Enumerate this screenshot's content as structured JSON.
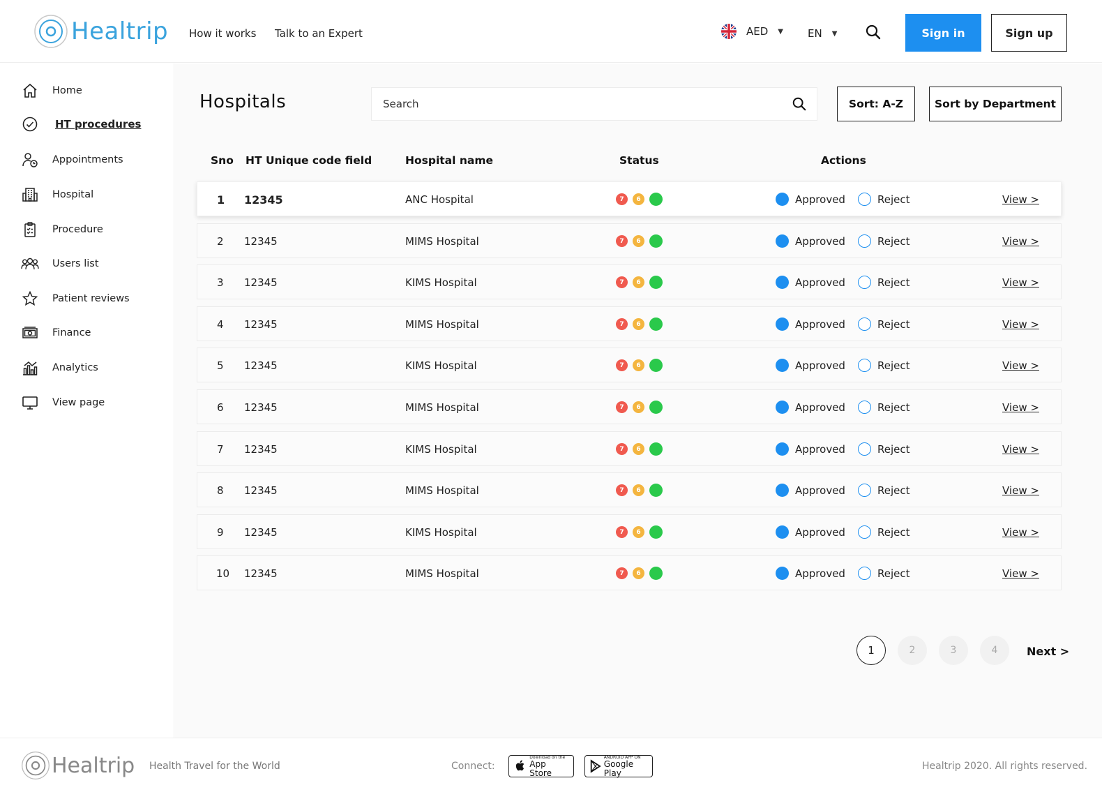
{
  "header": {
    "logo_text": "Healtrip",
    "nav": [
      "How it works",
      "Talk to an Expert"
    ],
    "currency": "AED",
    "language": "EN",
    "sign_in": "Sign in",
    "sign_up": "Sign up"
  },
  "sidebar": {
    "items": [
      {
        "label": "Home",
        "icon": "home-icon"
      },
      {
        "label": "HT procedures",
        "icon": "check-circle-icon",
        "active": true
      },
      {
        "label": "Appointments",
        "icon": "user-clock-icon"
      },
      {
        "label": "Hospital",
        "icon": "hospital-building-icon"
      },
      {
        "label": "Procedure",
        "icon": "clipboard-icon"
      },
      {
        "label": "Users list",
        "icon": "users-icon"
      },
      {
        "label": "Patient reviews",
        "icon": "star-icon"
      },
      {
        "label": "Finance",
        "icon": "cash-icon"
      },
      {
        "label": "Analytics",
        "icon": "analytics-icon"
      },
      {
        "label": "View page",
        "icon": "monitor-icon"
      }
    ]
  },
  "main": {
    "title": "Hospitals",
    "search_placeholder": "Search",
    "sort_az": "Sort: A-Z",
    "sort_department": "Sort by Department",
    "columns": {
      "sno": "Sno",
      "code": "HT Unique code field",
      "name": "Hospital name",
      "status": "Status",
      "actions": "Actions"
    },
    "rows": [
      {
        "sno": "1",
        "code": "12345",
        "name": "ANC Hospital",
        "s1": "7",
        "s2": "6",
        "approved": "Approved",
        "reject": "Reject",
        "view": "View >"
      },
      {
        "sno": "2",
        "code": "12345",
        "name": "MIMS Hospital",
        "s1": "7",
        "s2": "6",
        "approved": "Approved",
        "reject": "Reject",
        "view": "View >"
      },
      {
        "sno": "3",
        "code": "12345",
        "name": "KIMS Hospital",
        "s1": "7",
        "s2": "6",
        "approved": "Approved",
        "reject": "Reject",
        "view": "View >"
      },
      {
        "sno": "4",
        "code": "12345",
        "name": "MIMS Hospital",
        "s1": "7",
        "s2": "6",
        "approved": "Approved",
        "reject": "Reject",
        "view": "View >"
      },
      {
        "sno": "5",
        "code": "12345",
        "name": "KIMS Hospital",
        "s1": "7",
        "s2": "6",
        "approved": "Approved",
        "reject": "Reject",
        "view": "View >"
      },
      {
        "sno": "6",
        "code": "12345",
        "name": "MIMS Hospital",
        "s1": "7",
        "s2": "6",
        "approved": "Approved",
        "reject": "Reject",
        "view": "View >"
      },
      {
        "sno": "7",
        "code": "12345",
        "name": "KIMS Hospital",
        "s1": "7",
        "s2": "6",
        "approved": "Approved",
        "reject": "Reject",
        "view": "View >"
      },
      {
        "sno": "8",
        "code": "12345",
        "name": "MIMS Hospital",
        "s1": "7",
        "s2": "6",
        "approved": "Approved",
        "reject": "Reject",
        "view": "View >"
      },
      {
        "sno": "9",
        "code": "12345",
        "name": "KIMS Hospital",
        "s1": "7",
        "s2": "6",
        "approved": "Approved",
        "reject": "Reject",
        "view": "View >"
      },
      {
        "sno": "10",
        "code": "12345",
        "name": "MIMS Hospital",
        "s1": "7",
        "s2": "6",
        "approved": "Approved",
        "reject": "Reject",
        "view": "View >"
      }
    ],
    "pagination": {
      "pages": [
        "1",
        "2",
        "3",
        "4"
      ],
      "current": "1",
      "next": "Next >"
    }
  },
  "footer": {
    "logo_text": "Healtrip",
    "tagline": "Health Travel for the World",
    "connect": "Connect:",
    "app_store_small": "Download on the",
    "app_store_big": "App Store",
    "google_play_small": "ANDROID APP ON",
    "google_play_big": "Google Play",
    "copyright": "Healtrip 2020. All rights reserved."
  },
  "colors": {
    "brand_blue": "#1d8ff0",
    "logo_blue": "#3aa3dd",
    "status_red": "#f05a4f",
    "status_yellow": "#f4b53f",
    "status_green": "#2ac94b"
  }
}
